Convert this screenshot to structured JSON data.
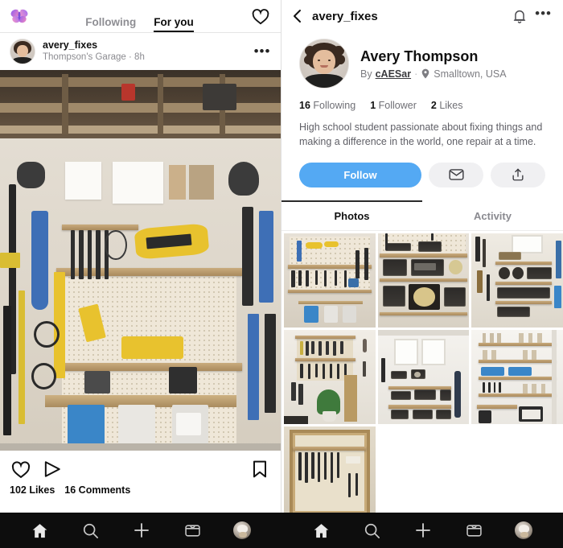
{
  "feed": {
    "logo_icon": "butterfly-logo",
    "tabs": [
      {
        "label": "Following",
        "active": false
      },
      {
        "label": "For you",
        "active": true
      }
    ],
    "heart_icon": "heart-icon",
    "post": {
      "username": "avery_fixes",
      "subtitle": "Thompson's Garage · 8h",
      "more_icon": "more-options-icon",
      "image_alt": "garage-workshop-tool-wall",
      "actions": {
        "like_icon": "heart-icon",
        "share_icon": "send-icon",
        "save_icon": "bookmark-icon"
      },
      "likes": "102 Likes",
      "comments": "16 Comments"
    }
  },
  "profile": {
    "back_icon": "back-chevron-icon",
    "title": "avery_fixes",
    "bell_icon": "bell-icon",
    "more_icon": "more-options-icon",
    "avatar_alt": "avery-thompson-avatar",
    "name": "Avery Thompson",
    "by_prefix": "By",
    "by_author": "cAESar",
    "separator": "·",
    "location_icon": "location-pin-icon",
    "location": "Smalltown, USA",
    "stats": [
      {
        "count": "16",
        "label": "Following"
      },
      {
        "count": "1",
        "label": "Follower"
      },
      {
        "count": "2",
        "label": "Likes"
      }
    ],
    "bio": "High school student passionate about fixing things and making a difference in the world, one repair at a time.",
    "follow_label": "Follow",
    "message_icon": "envelope-icon",
    "share_icon": "share-upload-icon",
    "accent_color": "#54a9f3",
    "tabs": [
      {
        "label": "Photos",
        "active": true
      },
      {
        "label": "Activity",
        "active": false
      }
    ],
    "grid": [
      {
        "alt": "tool-wall-with-bins",
        "kind": "toolwall"
      },
      {
        "alt": "shelf-of-vintage-radios",
        "kind": "radios"
      },
      {
        "alt": "workbench-with-gear",
        "kind": "bench"
      },
      {
        "alt": "hand-tools-and-plant",
        "kind": "plantwall"
      },
      {
        "alt": "window-bench-with-stereos",
        "kind": "window"
      },
      {
        "alt": "shelving-with-jars",
        "kind": "jars"
      },
      {
        "alt": "tool-cabinet-close-up",
        "kind": "cabinet"
      }
    ]
  },
  "bottom_nav": {
    "items": [
      {
        "icon": "home-icon",
        "active": true
      },
      {
        "icon": "search-icon",
        "active": false
      },
      {
        "icon": "add-icon",
        "active": false
      },
      {
        "icon": "inbox-icon",
        "active": false
      },
      {
        "icon": "profile-avatar-icon",
        "active": false
      }
    ]
  }
}
